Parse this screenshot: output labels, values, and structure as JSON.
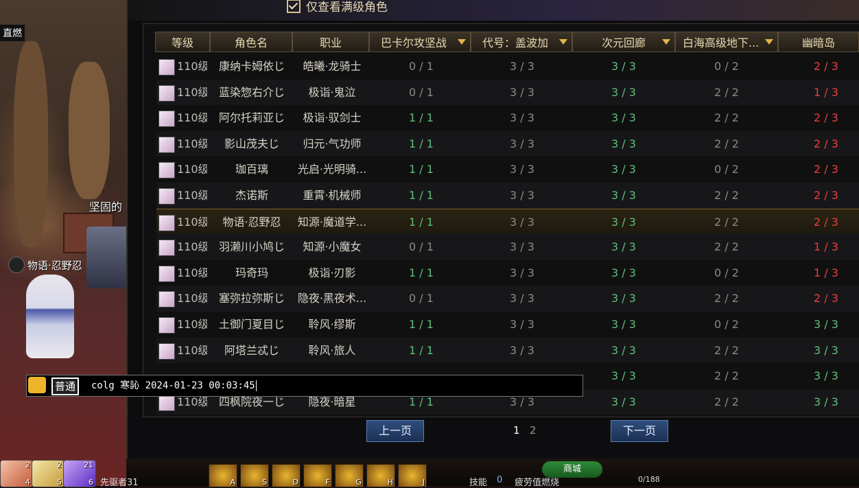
{
  "window": {
    "top_left_label": "直燃"
  },
  "world": {
    "npc_title": "坚固的",
    "character_name": "物语·忍野忍"
  },
  "filter": {
    "label": "仅查看满级角色",
    "checked": true
  },
  "table": {
    "headers": [
      "等级",
      "角色名",
      "职业",
      "巴卡尔攻坚战",
      "代号：盖波加",
      "次元回廊",
      "白海高级地下...",
      "幽暗岛"
    ],
    "dropdown_columns": [
      3,
      4,
      5,
      6
    ],
    "rows": [
      {
        "level": "110级",
        "name": "康纳卡姆依じ",
        "job": "皓曦·龙骑士",
        "v": [
          "0 / 1",
          "3 / 3",
          "3 / 3",
          "0 / 2",
          "2 / 3"
        ]
      },
      {
        "level": "110级",
        "name": "蓝染惣右介じ",
        "job": "极诣·鬼泣",
        "v": [
          "0 / 1",
          "3 / 3",
          "3 / 3",
          "2 / 2",
          "1 / 3"
        ]
      },
      {
        "level": "110级",
        "name": "阿尔托莉亚じ",
        "job": "极诣·驭剑士",
        "v": [
          "1 / 1",
          "3 / 3",
          "3 / 3",
          "2 / 2",
          "2 / 3"
        ]
      },
      {
        "level": "110级",
        "name": "影山茂夫じ",
        "job": "归元·气功师",
        "v": [
          "1 / 1",
          "3 / 3",
          "3 / 3",
          "2 / 2",
          "2 / 3"
        ]
      },
      {
        "level": "110级",
        "name": "珈百璃",
        "job": "光启·光明骑...",
        "v": [
          "1 / 1",
          "3 / 3",
          "3 / 3",
          "0 / 2",
          "2 / 3"
        ]
      },
      {
        "level": "110级",
        "name": "杰诺斯",
        "job": "重霄·机械师",
        "v": [
          "1 / 1",
          "3 / 3",
          "3 / 3",
          "2 / 2",
          "2 / 3"
        ]
      },
      {
        "level": "110级",
        "name": "物语·忍野忍",
        "job": "知源·魔道学...",
        "v": [
          "1 / 1",
          "3 / 3",
          "3 / 3",
          "2 / 2",
          "2 / 3"
        ],
        "selected": true
      },
      {
        "level": "110级",
        "name": "羽濑川小鸠じ",
        "job": "知源·小魔女",
        "v": [
          "0 / 1",
          "3 / 3",
          "3 / 3",
          "2 / 2",
          "1 / 3"
        ]
      },
      {
        "level": "110级",
        "name": "玛奇玛",
        "job": "极诣·刃影",
        "v": [
          "1 / 1",
          "3 / 3",
          "3 / 3",
          "0 / 2",
          "1 / 3"
        ]
      },
      {
        "level": "110级",
        "name": "塞弥拉弥斯じ",
        "job": "隐夜·黑夜术...",
        "v": [
          "0 / 1",
          "3 / 3",
          "3 / 3",
          "2 / 2",
          "2 / 3"
        ]
      },
      {
        "level": "110级",
        "name": "土御门夏目じ",
        "job": "聆风·缪斯",
        "v": [
          "1 / 1",
          "3 / 3",
          "3 / 3",
          "0 / 2",
          "3 / 3"
        ]
      },
      {
        "level": "110级",
        "name": "阿塔兰忒じ",
        "job": "聆风·旅人",
        "v": [
          "1 / 1",
          "3 / 3",
          "3 / 3",
          "2 / 2",
          "3 / 3"
        ]
      },
      {
        "level": "",
        "name": "",
        "job": "",
        "v": [
          "",
          "",
          "3 / 3",
          "2 / 2",
          "3 / 3"
        ]
      },
      {
        "level": "110级",
        "name": "四枫院夜一じ",
        "job": "隐夜·暗星",
        "v": [
          "1 / 1",
          "3 / 3",
          "3 / 3",
          "2 / 2",
          "3 / 3"
        ]
      }
    ]
  },
  "pagination": {
    "prev": "上一页",
    "next": "下一页",
    "pages": [
      "1",
      "2"
    ],
    "current": "1"
  },
  "chat": {
    "channel": "普通",
    "text": "colg 寒訫 2024-01-23 00:03:45"
  },
  "hotbar": {
    "items": [
      {
        "count": "2",
        "key": "4"
      },
      {
        "count": "2",
        "key": "5"
      },
      {
        "count": "21",
        "key": "6"
      }
    ],
    "player_name": "先驱者31",
    "skill_keys": [
      "A",
      "S",
      "D",
      "F",
      "G",
      "H",
      "J"
    ],
    "skill_label": "技能",
    "skill_points": "0",
    "shop_label": "商城",
    "fatigue_label": "疲劳值燃烧",
    "fatigue_value": "0/188"
  },
  "colors": {
    "green": "#5ec07a",
    "red": "#e64040",
    "grey": "#8d8a84",
    "header_text": "#e7d8b0",
    "accent_gold": "#e1b64a"
  }
}
